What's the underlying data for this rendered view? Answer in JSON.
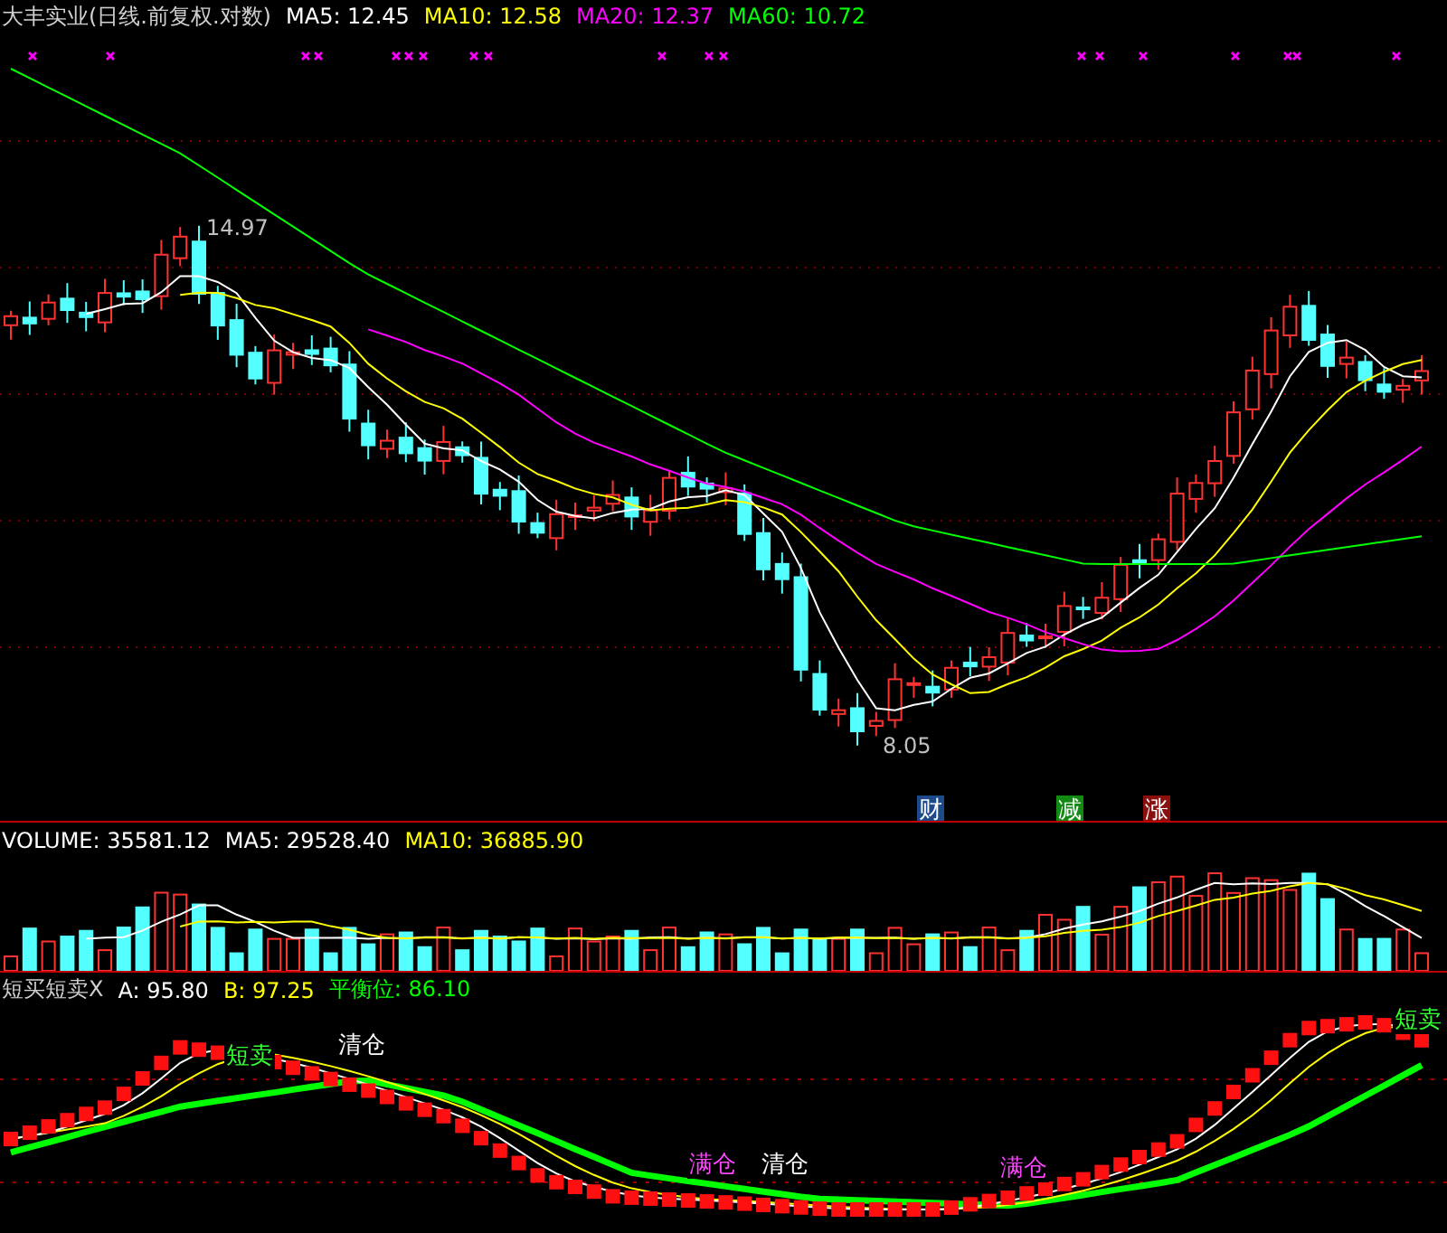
{
  "price_panel": {
    "title": "大丰实业(日线.前复权.对数)",
    "indicators": [
      {
        "label": "MA5: 12.45",
        "color": "#ffffff"
      },
      {
        "label": "MA10: 12.58",
        "color": "#ffff00"
      },
      {
        "label": "MA20: 12.37",
        "color": "#ff00ff"
      },
      {
        "label": "MA60: 10.72",
        "color": "#00ff00"
      }
    ],
    "high_label": "14.97",
    "low_label": "8.05",
    "markers": [
      {
        "text": "财",
        "color": "#1c4a8a"
      },
      {
        "text": "减",
        "color": "#138a13"
      },
      {
        "text": "涨",
        "color": "#8a1010"
      }
    ]
  },
  "volume_panel": {
    "indicators": [
      {
        "label": "VOLUME: 35581.12",
        "color": "#ffffff"
      },
      {
        "label": "MA5: 29528.40",
        "color": "#ffffff"
      },
      {
        "label": "MA10: 36885.90",
        "color": "#ffff00"
      }
    ]
  },
  "indicator_panel": {
    "title": "短买短卖X",
    "indicators": [
      {
        "label": "A: 95.80",
        "color": "#ffffff"
      },
      {
        "label": "B: 97.25",
        "color": "#ffff00"
      },
      {
        "label": "平衡位: 86.10",
        "color": "#00ff00"
      }
    ],
    "signals": [
      {
        "text": "短卖",
        "color": "#33ff33"
      },
      {
        "text": "清仓",
        "color": "#ffffff"
      },
      {
        "text": "满仓",
        "color": "#ff44ff"
      },
      {
        "text": "清仓",
        "color": "#ffffff"
      },
      {
        "text": "满仓",
        "color": "#ff44ff"
      },
      {
        "text": "短卖",
        "color": "#33ff33"
      }
    ]
  }
}
